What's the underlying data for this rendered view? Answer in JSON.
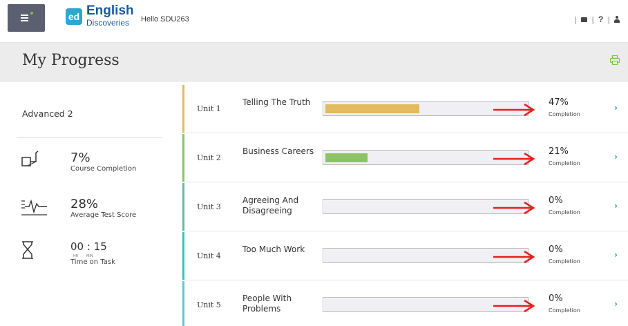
{
  "topbar": {
    "brand_short": "ed",
    "brand_main": "English",
    "brand_sub": "Discoveries",
    "greeting": "Hello SDU263",
    "separator": "|",
    "help_label": "?"
  },
  "header": {
    "title": "My Progress"
  },
  "sidebar": {
    "level": "Advanced 2",
    "course_completion": {
      "value": "7%",
      "label": "Course Completion"
    },
    "test_score": {
      "value": "28%",
      "label": "Average Test Score"
    },
    "time_on_task": {
      "value": "00 : 15",
      "hr": "HR",
      "min": "MIN",
      "label": "Time on Task"
    }
  },
  "units": [
    {
      "number": "Unit 1",
      "name": "Telling The Truth",
      "percent": "47%",
      "progress": 0.47,
      "completion_label": "Completion",
      "color": "#e3bb5e",
      "edge_color": "#e3bb5e"
    },
    {
      "number": "Unit 2",
      "name": "Business Careers",
      "percent": "21%",
      "progress": 0.21,
      "completion_label": "Completion",
      "color": "#8cc365",
      "edge_color": "#8cc365"
    },
    {
      "number": "Unit 3",
      "name": "Agreeing And Disagreeing",
      "percent": "0%",
      "progress": 0,
      "completion_label": "Completion",
      "color": "#5cc09a",
      "edge_color": "#5cc09a"
    },
    {
      "number": "Unit 4",
      "name": "Too Much Work",
      "percent": "0%",
      "progress": 0,
      "completion_label": "Completion",
      "color": "#3fbdbf",
      "edge_color": "#3fbdbf"
    },
    {
      "number": "Unit 5",
      "name": "People With Problems",
      "percent": "0%",
      "progress": 0,
      "completion_label": "Completion",
      "color": "#5cc8d8",
      "edge_color": "#5cc8d8"
    }
  ],
  "colors": {
    "menu_bg": "#5b5f70",
    "brand_blue": "#1a5a9c",
    "accent_teal": "#2ba7a3",
    "annotation_arrow": "#e81d1d"
  },
  "icons": [
    "menu-icon",
    "book-icon",
    "help-icon",
    "user-icon",
    "print-icon",
    "course-icon",
    "score-icon",
    "hourglass-icon",
    "chevron-right-icon"
  ]
}
